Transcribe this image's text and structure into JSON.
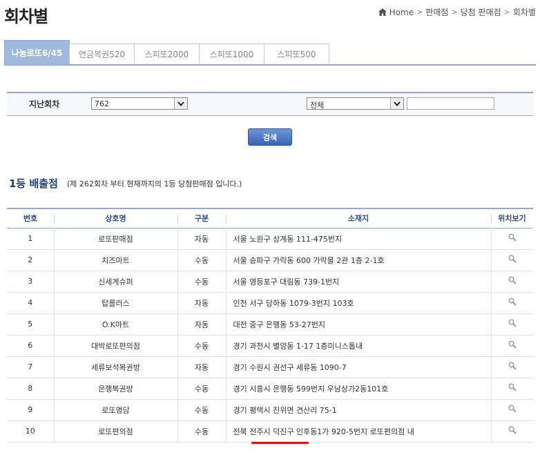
{
  "page": {
    "title": "회차별"
  },
  "breadcrumb": {
    "items": [
      "Home",
      "판매점",
      "당첨 판매점",
      "회차별"
    ]
  },
  "tabs": [
    {
      "label": "나눔로또6/45",
      "active": true
    },
    {
      "label": "연금복권520",
      "active": false
    },
    {
      "label": "스피또2000",
      "active": false
    },
    {
      "label": "스피또1000",
      "active": false
    },
    {
      "label": "스피또500",
      "active": false
    }
  ],
  "filter": {
    "label": "지난회차",
    "round_value": "762",
    "region_value": "전체",
    "keyword_value": ""
  },
  "search_button": {
    "label": "검색"
  },
  "section": {
    "title_num": "1등",
    "title_text": "배출점",
    "subtitle": "(제 262회차 부터 현재까지의 1등 당첨판매점 입니다.)"
  },
  "table": {
    "headers": [
      "번호",
      "상호명",
      "구분",
      "소재지",
      "위치보기"
    ],
    "rows": [
      {
        "no": "1",
        "name": "로또판매점",
        "type": "자동",
        "addr": "서울 노원구 상계동 111-475번지"
      },
      {
        "no": "2",
        "name": "치즈마트",
        "type": "수동",
        "addr": "서울 송파구 가락동 600 가락몰 2관 1층 2-1호"
      },
      {
        "no": "3",
        "name": "신세계슈퍼",
        "type": "수동",
        "addr": "서울 영등포구 대림동 739-1번지"
      },
      {
        "no": "4",
        "name": "탑플러스",
        "type": "자동",
        "addr": "인천 서구 당하동 1079-3번지 103호"
      },
      {
        "no": "5",
        "name": "O.K마트",
        "type": "자동",
        "addr": "대전 중구 은행동 53-27번지"
      },
      {
        "no": "6",
        "name": "대박로또편의점",
        "type": "수동",
        "addr": "경기 과천시 별양동 1-17 1층미니스톱내"
      },
      {
        "no": "7",
        "name": "세류보석복권방",
        "type": "자동",
        "addr": "경기 수원시 권선구 세류동 1090-7"
      },
      {
        "no": "8",
        "name": "은행복권방",
        "type": "수동",
        "addr": "경기 시흥시 은행동 599번지 우남상가2동101호"
      },
      {
        "no": "9",
        "name": "로또명당",
        "type": "수동",
        "addr": "경기 평택시 진위면 견산리 75-1"
      },
      {
        "no": "10",
        "name": "로또편의점",
        "type": "수동",
        "addr": "전북 전주시 덕진구 인후동1가 920-5번지 로또편의점 내"
      }
    ]
  },
  "icons": {
    "home": "home-icon",
    "view": "magnifier-icon",
    "dropdown": "chevron-down-icon"
  },
  "colors": {
    "accent": "#8da9cc",
    "tab_active": "#9fb9dc",
    "button": "#4a72c0",
    "title": "#1d3f7a",
    "annotation": "#e01010"
  }
}
